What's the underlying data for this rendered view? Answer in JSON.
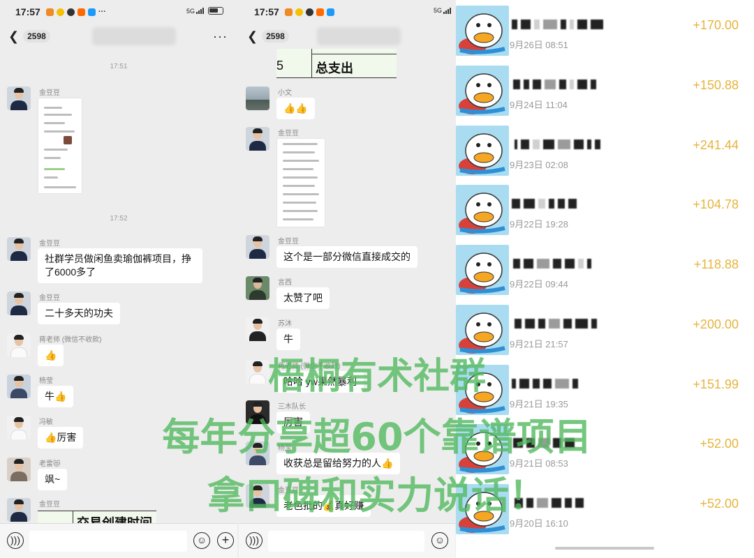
{
  "status_time": "17:57",
  "status_network": "5G",
  "unread_count": "2598",
  "left_chat": {
    "timestamps": [
      "17:51",
      "17:52"
    ],
    "messages": [
      {
        "sender": "金豆豆",
        "text": ""
      },
      {
        "sender": "金豆豆",
        "text": "社群学员做闲鱼卖瑜伽裤项目，挣了6000多了"
      },
      {
        "sender": "金豆豆",
        "text": "二十多天的功夫"
      },
      {
        "sender": "蒋老师 (微信不收款)",
        "text": "👍"
      },
      {
        "sender": "杨莹",
        "text": "牛👍"
      },
      {
        "sender": "冯敏",
        "text": "👍厉害"
      },
      {
        "sender": "老雷😻",
        "text": "飒~"
      },
      {
        "sender": "金豆豆",
        "text": ""
      }
    ],
    "table_header": "交易创建时间"
  },
  "middle_chat": {
    "table_footer": "总支出",
    "table_number": "5",
    "messages": [
      {
        "sender": "小文",
        "text": "👍👍"
      },
      {
        "sender": "金豆豆",
        "text": ""
      },
      {
        "sender": "金豆豆",
        "text": "这个是一部分微信直接成交的"
      },
      {
        "sender": "言西",
        "text": "太赞了吧"
      },
      {
        "sender": "苏沐",
        "text": "牛"
      },
      {
        "sender": "蒋老师 (微信不收款)",
        "text": "哈哈 yw果然暴利"
      },
      {
        "sender": "三木队长",
        "text": "厉害"
      },
      {
        "sender": "杨莹",
        "text": "收获总是留给努力的人👍"
      },
      {
        "sender": "金豆豆",
        "text": "老色批的💰真好赚"
      }
    ]
  },
  "transactions": [
    {
      "time": "9月26日 08:51",
      "amount": "+170.00"
    },
    {
      "time": "9月24日 11:04",
      "amount": "+150.88"
    },
    {
      "time": "9月23日 02:08",
      "amount": "+241.44"
    },
    {
      "time": "9月22日 19:28",
      "amount": "+104.78"
    },
    {
      "time": "9月22日 09:44",
      "amount": "+118.88"
    },
    {
      "time": "9月21日 21:57",
      "amount": "+200.00"
    },
    {
      "time": "9月21日 19:35",
      "amount": "+151.99"
    },
    {
      "time": "9月21日 08:53",
      "amount": "+52.00"
    },
    {
      "time": "9月20日 16:10",
      "amount": "+52.00"
    }
  ],
  "watermark": {
    "line1": "梧桐有术社群",
    "line2": "每年分享超60个靠谱项目",
    "line3": "拿口碑和实力说话！"
  },
  "colors": {
    "amount": "#e6b43c",
    "watermark": "#52b95f",
    "chat_bg": "#ededed",
    "bubble_bg": "#ffffff"
  },
  "icons": [
    "back-arrow-icon",
    "more-icon",
    "voice-icon",
    "emoji-icon",
    "plus-icon",
    "duck-avatar-icon"
  ]
}
